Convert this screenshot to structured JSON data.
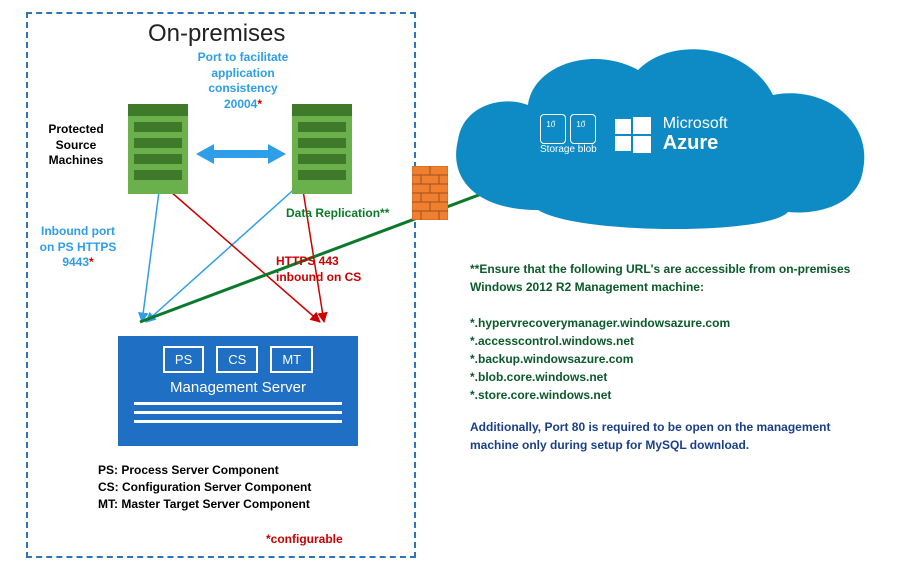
{
  "onprem": {
    "title": "On-premises",
    "port_note_l1": "Port to facilitate",
    "port_note_l2": "application",
    "port_note_l3": "consistency",
    "port_note_port": "20004",
    "port_note_star": "*",
    "protected_label": "Protected Source Machines",
    "inbound_l1": "Inbound port",
    "inbound_l2": "on PS HTTPS",
    "inbound_port": "9443",
    "inbound_star": "*",
    "https_l1": "HTTPS 443",
    "https_l2": "inbound on CS",
    "mgmt": {
      "ps": "PS",
      "cs": "CS",
      "mt": "MT",
      "title": "Management Server"
    },
    "legend": {
      "ps": "PS: Process Server Component",
      "cs": "CS: Configuration Server Component",
      "mt": "MT: Master Target Server Component"
    },
    "configurable": "*configurable"
  },
  "cloud": {
    "storage_label": "Storage blob",
    "azure_brand1": "Microsoft",
    "azure_brand2": "Azure"
  },
  "data_replication": "Data Replication**",
  "urls": {
    "header": "**Ensure that the following URL's are accessible from on-premises Windows 2012 R2 Management machine:",
    "list": [
      "*.hypervrecoverymanager.windowsazure.com",
      "*.accesscontrol.windows.net",
      "*.backup.windowsazure.com",
      "*.blob.core.windows.net",
      "*.store.core.windows.net"
    ],
    "port80": "Additionally, Port 80 is required to be open on the management machine only during setup for MySQL download."
  }
}
